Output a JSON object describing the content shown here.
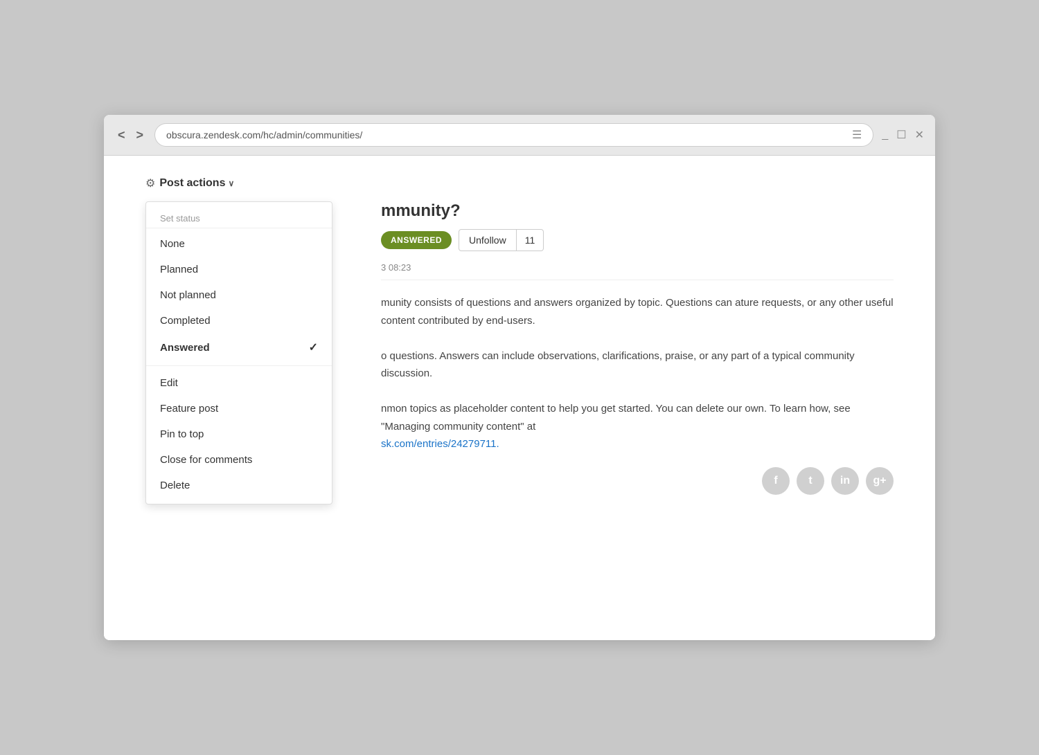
{
  "browser": {
    "url": "obscura.zendesk.com/hc/admin/communities/",
    "back_label": "<",
    "forward_label": ">",
    "minimize": "_",
    "maximize": "☐",
    "close": "✕"
  },
  "post_actions": {
    "label": "Post actions",
    "chevron": "∨",
    "dropdown": {
      "set_status_label": "Set status",
      "items_status": [
        {
          "label": "None",
          "checked": false,
          "bold": false
        },
        {
          "label": "Planned",
          "checked": false,
          "bold": false
        },
        {
          "label": "Not planned",
          "checked": false,
          "bold": false
        },
        {
          "label": "Completed",
          "checked": false,
          "bold": false
        },
        {
          "label": "Answered",
          "checked": true,
          "bold": true
        }
      ],
      "items_actions": [
        {
          "label": "Edit",
          "checked": false,
          "bold": false
        },
        {
          "label": "Feature post",
          "checked": false,
          "bold": false
        },
        {
          "label": "Pin to top",
          "checked": false,
          "bold": false
        },
        {
          "label": "Close for comments",
          "checked": false,
          "bold": false
        },
        {
          "label": "Delete",
          "checked": false,
          "bold": false
        }
      ]
    }
  },
  "post": {
    "title": "mmunity?",
    "answered_badge": "ANSWERED",
    "unfollow_label": "Unfollow",
    "follow_count": "11",
    "timestamp": "3 08:23",
    "body_1": "munity consists of questions and answers organized by topic. Questions can ature requests, or any other useful content contributed by end-users.",
    "body_2": "o questions. Answers can include observations, clarifications, praise, or any part of a typical community discussion.",
    "body_3": "nmon topics as placeholder content to help you get started. You can delete our own. To learn how, see \"Managing community content\" at",
    "link_text": "sk.com/entries/24279711.",
    "link_href": "#"
  },
  "social": {
    "facebook": "f",
    "twitter": "t",
    "linkedin": "in",
    "googleplus": "g+"
  }
}
